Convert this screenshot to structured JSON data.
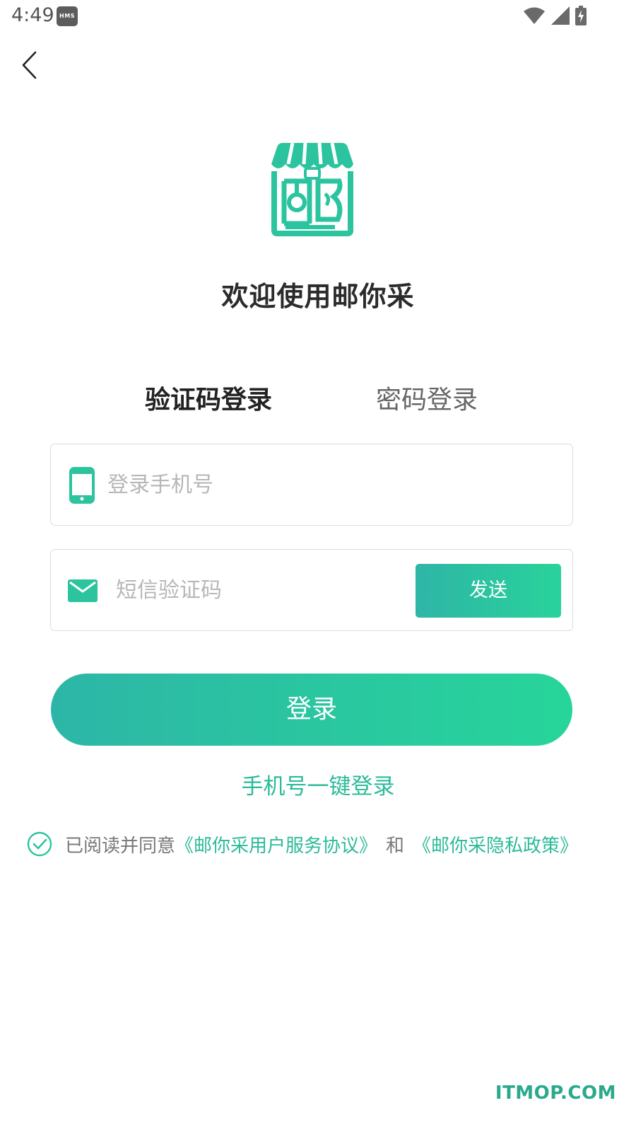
{
  "status_bar": {
    "time": "4:49",
    "hms_badge": "HMS",
    "icons": [
      "wifi-icon",
      "signal-icon",
      "battery-charging-icon"
    ]
  },
  "nav": {
    "back_icon": "chevron-left-icon"
  },
  "brand": {
    "logo_icon": "shop-logo-icon",
    "accent_color": "#2bc49e"
  },
  "welcome_title": "欢迎使用邮你采",
  "tabs": [
    {
      "label": "验证码登录",
      "selected": true
    },
    {
      "label": "密码登录",
      "selected": false
    }
  ],
  "form": {
    "phone": {
      "placeholder": "登录手机号",
      "value": "",
      "icon": "phone-icon"
    },
    "code": {
      "placeholder": "短信验证码",
      "value": "",
      "icon": "mail-icon"
    },
    "send_label": "发送"
  },
  "login_label": "登录",
  "onekey_login": "手机号一键登录",
  "agreement": {
    "checked": true,
    "prefix": "已阅读并同意",
    "service_link": "《邮你采用户服务协议》",
    "and": "和",
    "privacy_link": "《邮你采隐私政策》"
  },
  "watermark": "ITMOP.COM"
}
